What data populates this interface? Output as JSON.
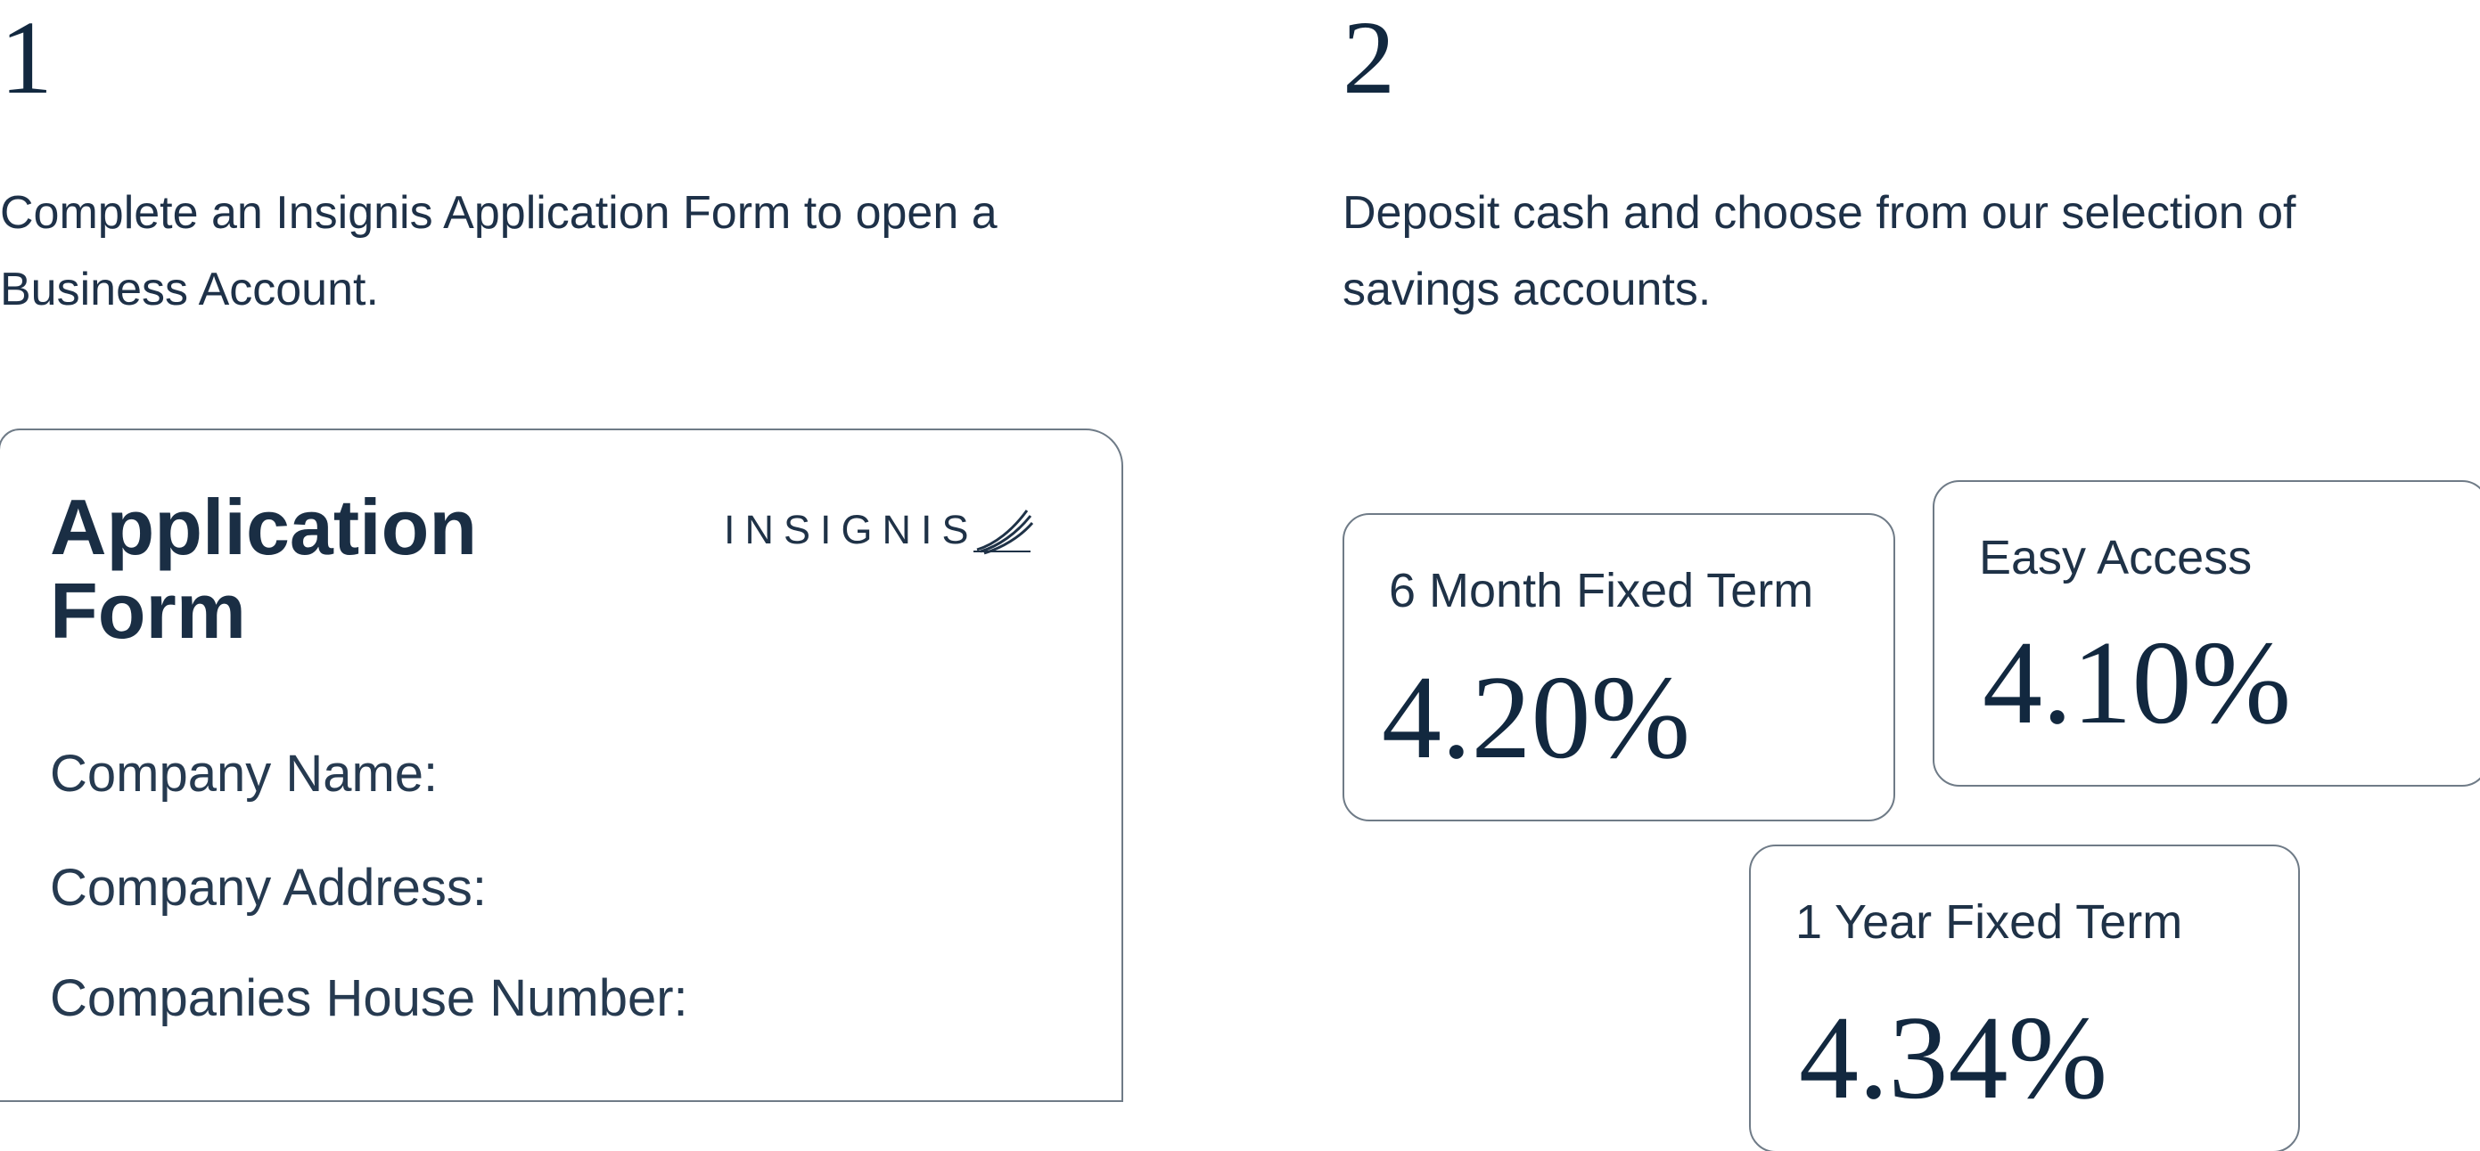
{
  "steps": [
    {
      "number": "1",
      "description": "Complete an Insignis Application Form to open a Business Account."
    },
    {
      "number": "2",
      "description": "Deposit cash and choose from our selection of savings accounts."
    }
  ],
  "application_form": {
    "title": "Application Form",
    "brand": "INSIGNIS",
    "brand_icon": "feather-icon",
    "fields": [
      "Company Name:",
      "Company Address:",
      "Companies House Number:"
    ]
  },
  "accounts": [
    {
      "label": "6 Month Fixed Term",
      "rate": "4.20%"
    },
    {
      "label": "Easy Access",
      "rate": "4.10%"
    },
    {
      "label": "1 Year Fixed Term",
      "rate": "4.34%"
    }
  ],
  "colors": {
    "text_primary": "#12283f",
    "border": "#6f7b87",
    "background": "#ffffff"
  }
}
